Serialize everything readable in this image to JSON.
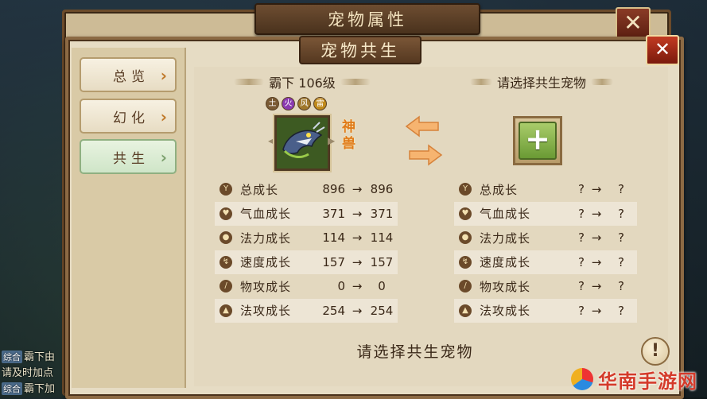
{
  "window": {
    "outer_title": "宠物属性",
    "outer_close": "✕"
  },
  "panel": {
    "title": "宠物共生",
    "close": "✕"
  },
  "sidebar": {
    "tabs": [
      {
        "label": "总览",
        "chev": "›"
      },
      {
        "label": "幻化",
        "chev": "›"
      },
      {
        "label": "共生",
        "chev": "›"
      }
    ]
  },
  "left_pet": {
    "header": "霸下 106级",
    "badge": "神兽",
    "element_icons": [
      "土",
      "火",
      "风",
      "雷"
    ],
    "stats": [
      {
        "icon": "grow-icon",
        "label": "总成长",
        "from": "896",
        "arrow": "→",
        "to": "896"
      },
      {
        "icon": "heart-icon",
        "label": "气血成长",
        "from": "371",
        "arrow": "→",
        "to": "371"
      },
      {
        "icon": "drop-icon",
        "label": "法力成长",
        "from": "114",
        "arrow": "→",
        "to": "114"
      },
      {
        "icon": "speed-icon",
        "label": "速度成长",
        "from": "157",
        "arrow": "→",
        "to": "157"
      },
      {
        "icon": "sword-icon",
        "label": "物攻成长",
        "from": "0",
        "arrow": "→",
        "to": "0"
      },
      {
        "icon": "flame-icon",
        "label": "法攻成长",
        "from": "254",
        "arrow": "→",
        "to": "254"
      }
    ]
  },
  "right_pet": {
    "header": "请选择共生宠物",
    "stats": [
      {
        "icon": "grow-icon",
        "label": "总成长",
        "from": "?",
        "arrow": "→",
        "to": "?"
      },
      {
        "icon": "heart-icon",
        "label": "气血成长",
        "from": "?",
        "arrow": "→",
        "to": "?"
      },
      {
        "icon": "drop-icon",
        "label": "法力成长",
        "from": "?",
        "arrow": "→",
        "to": "?"
      },
      {
        "icon": "speed-icon",
        "label": "速度成长",
        "from": "?",
        "arrow": "→",
        "to": "?"
      },
      {
        "icon": "sword-icon",
        "label": "物攻成长",
        "from": "?",
        "arrow": "→",
        "to": "?"
      },
      {
        "icon": "flame-icon",
        "label": "法攻成长",
        "from": "?",
        "arrow": "→",
        "to": "?"
      }
    ]
  },
  "add_slot": {
    "plus": "+"
  },
  "bottom": {
    "prompt": "请选择共生宠物",
    "help": "!"
  },
  "background_chat": [
    "霸下由",
    "请及时加点",
    "霸下加"
  ],
  "watermark": {
    "text": "华南手游网"
  },
  "colors": {
    "accent_orange": "#e07a18",
    "panel_brown": "#6b4a2a",
    "plus_green": "#6a9a34",
    "close_red": "#c23a22"
  }
}
